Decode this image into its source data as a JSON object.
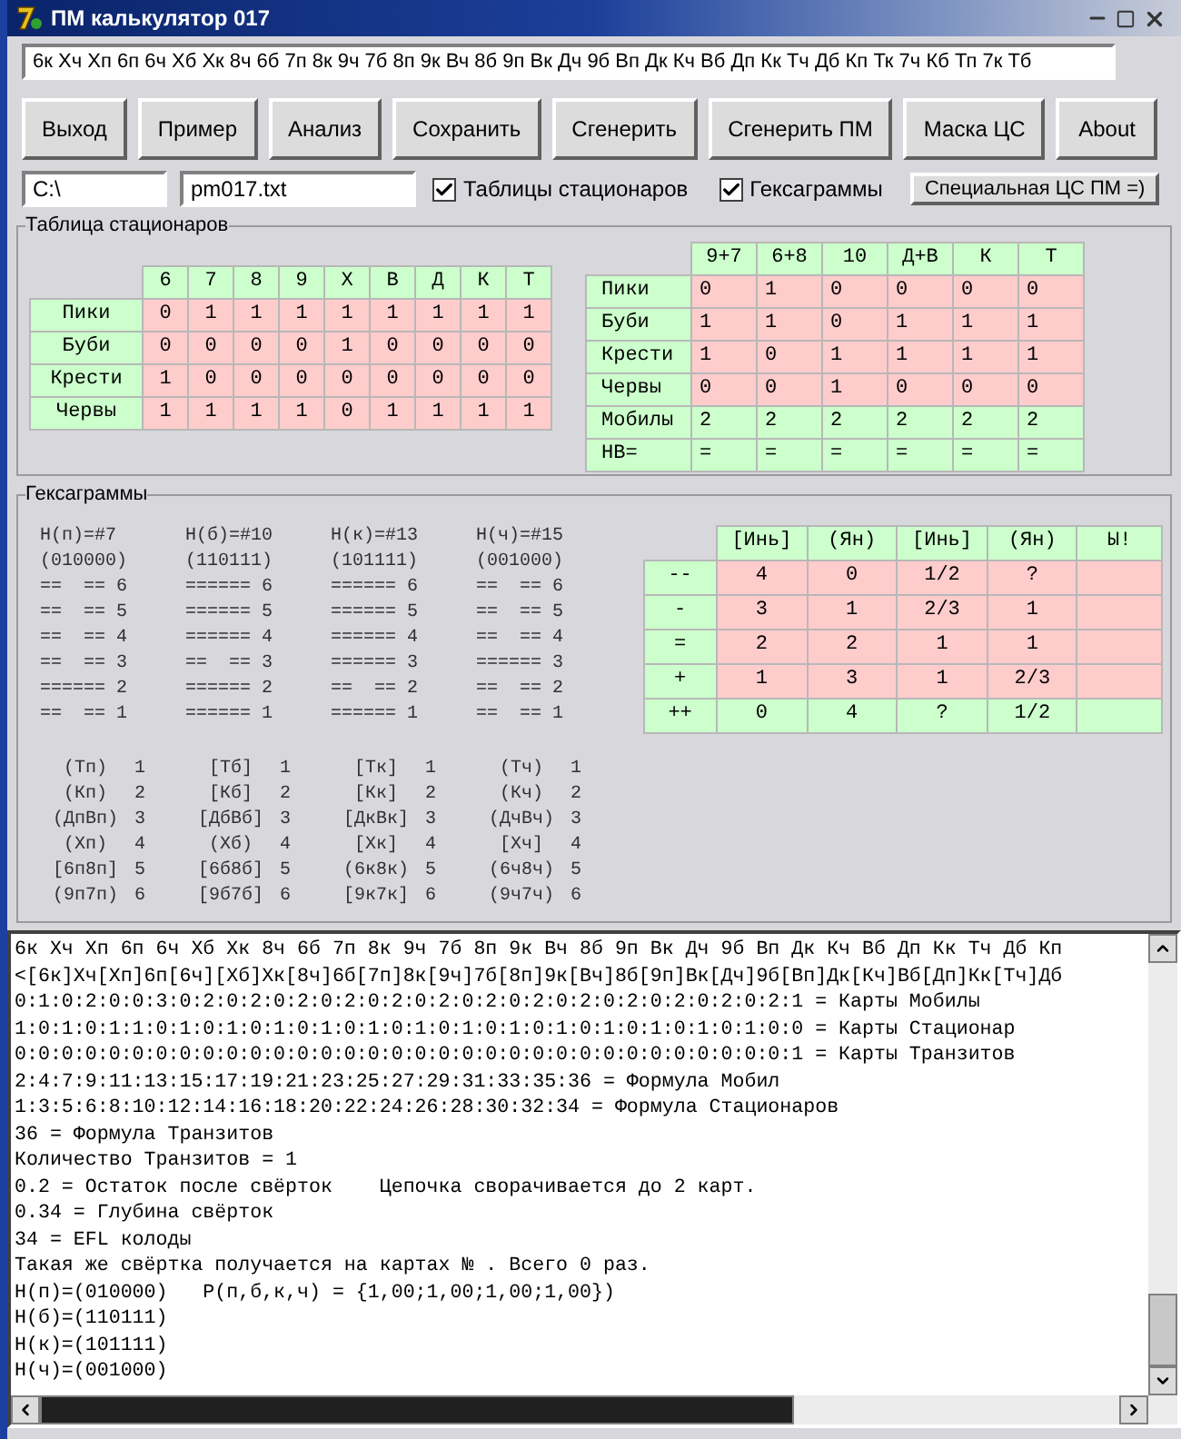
{
  "window": {
    "title": "ПМ калькулятор 017"
  },
  "sequence_field": {
    "value": "6к Хч Хп 6п 6ч Хб Хк 8ч 6б 7п 8к 9ч 7б 8п 9к Вч 8б 9п Вк Дч 9б Вп Дк Кч Вб Дп Кк Тч Дб Кп Тк 7ч Кб Тп 7к Тб"
  },
  "buttons": [
    "Выход",
    "Пример",
    "Анализ",
    "Сохранить",
    "Сгенерить",
    "Сгенерить ПМ",
    "Маска ЦС",
    "About"
  ],
  "path_field": {
    "value": "C:\\"
  },
  "file_field": {
    "value": "pm017.txt"
  },
  "checkboxes": [
    {
      "label": "Таблицы стационаров",
      "checked": true
    },
    {
      "label": "Гексаграммы",
      "checked": true
    }
  ],
  "special_button": "Специальная ЦС ПМ =)",
  "stationary_group": {
    "title": "Таблица стационаров",
    "left_table": {
      "columns": [
        "6",
        "7",
        "8",
        "9",
        "Х",
        "В",
        "Д",
        "К",
        "Т"
      ],
      "rows": [
        {
          "label": "Пики",
          "kind": "suit",
          "cells": [
            "0",
            "1",
            "1",
            "1",
            "1",
            "1",
            "1",
            "1",
            "1"
          ]
        },
        {
          "label": "Буби",
          "kind": "suit",
          "cells": [
            "0",
            "0",
            "0",
            "0",
            "1",
            "0",
            "0",
            "0",
            "0"
          ]
        },
        {
          "label": "Крести",
          "kind": "suit",
          "cells": [
            "1",
            "0",
            "0",
            "0",
            "0",
            "0",
            "0",
            "0",
            "0"
          ]
        },
        {
          "label": "Червы",
          "kind": "suit",
          "cells": [
            "1",
            "1",
            "1",
            "1",
            "0",
            "1",
            "1",
            "1",
            "1"
          ]
        }
      ]
    },
    "right_table": {
      "columns": [
        "9+7",
        "6+8",
        "10",
        "Д+В",
        "К",
        "Т"
      ],
      "rows": [
        {
          "label": "Пики",
          "kind": "suit",
          "cells": [
            "0",
            "1",
            "0",
            "0",
            "0",
            "0"
          ]
        },
        {
          "label": "Буби",
          "kind": "suit",
          "cells": [
            "1",
            "1",
            "0",
            "1",
            "1",
            "1"
          ]
        },
        {
          "label": "Крести",
          "kind": "suit",
          "cells": [
            "1",
            "0",
            "1",
            "1",
            "1",
            "1"
          ]
        },
        {
          "label": "Червы",
          "kind": "suit",
          "cells": [
            "0",
            "0",
            "1",
            "0",
            "0",
            "0"
          ]
        },
        {
          "label": "Мобилы",
          "kind": "total",
          "cells": [
            "2",
            "2",
            "2",
            "2",
            "2",
            "2"
          ]
        },
        {
          "label": "НВ=",
          "kind": "total",
          "cells": [
            "=",
            "=",
            "=",
            "=",
            "=",
            "="
          ]
        }
      ]
    }
  },
  "hexagram_group": {
    "title": "Гексаграммы",
    "hexagrams": [
      {
        "title": "Н(п)=#7",
        "code": "(010000)",
        "lines": [
          "==  == 6",
          "==  == 5",
          "==  == 4",
          "==  == 3",
          "====== 2",
          "==  == 1"
        ],
        "cards": [
          {
            "label": "(Тп)",
            "number": "1"
          },
          {
            "label": "(Кп)",
            "number": "2"
          },
          {
            "label": "(ДпВп)",
            "number": "3"
          },
          {
            "label": "(Хп)",
            "number": "4"
          },
          {
            "label": "[6п8п]",
            "number": "5"
          },
          {
            "label": "(9п7п)",
            "number": "6"
          }
        ]
      },
      {
        "title": "Н(б)=#10",
        "code": "(110111)",
        "lines": [
          "====== 6",
          "====== 5",
          "====== 4",
          "==  == 3",
          "====== 2",
          "====== 1"
        ],
        "cards": [
          {
            "label": "[Тб]",
            "number": "1"
          },
          {
            "label": "[Кб]",
            "number": "2"
          },
          {
            "label": "[ДбВб]",
            "number": "3"
          },
          {
            "label": "(Хб)",
            "number": "4"
          },
          {
            "label": "[6б8б]",
            "number": "5"
          },
          {
            "label": "[9б7б]",
            "number": "6"
          }
        ]
      },
      {
        "title": "Н(к)=#13",
        "code": "(101111)",
        "lines": [
          "====== 6",
          "====== 5",
          "====== 4",
          "====== 3",
          "==  == 2",
          "====== 1"
        ],
        "cards": [
          {
            "label": "[Тк]",
            "number": "1"
          },
          {
            "label": "[Кк]",
            "number": "2"
          },
          {
            "label": "[ДкВк]",
            "number": "3"
          },
          {
            "label": "[Хк]",
            "number": "4"
          },
          {
            "label": "(6к8к)",
            "number": "5"
          },
          {
            "label": "[9к7к]",
            "number": "6"
          }
        ]
      },
      {
        "title": "Н(ч)=#15",
        "code": "(001000)",
        "lines": [
          "==  == 6",
          "==  == 5",
          "==  == 4",
          "====== 3",
          "==  == 2",
          "==  == 1"
        ],
        "cards": [
          {
            "label": "(Тч)",
            "number": "1"
          },
          {
            "label": "(Кч)",
            "number": "2"
          },
          {
            "label": "(ДчВч)",
            "number": "3"
          },
          {
            "label": "[Хч]",
            "number": "4"
          },
          {
            "label": "(6ч8ч)",
            "number": "5"
          },
          {
            "label": "(9ч7ч)",
            "number": "6"
          }
        ]
      }
    ],
    "yin_yang_table": {
      "columns": [
        "[Инь]",
        "(Ян)",
        "[Инь]",
        "(Ян)",
        "Ы!"
      ],
      "rows": [
        {
          "label": "--",
          "kind": "level",
          "cells": [
            "4",
            "0",
            "1/2",
            "?",
            ""
          ]
        },
        {
          "label": "-",
          "kind": "level",
          "cells": [
            "3",
            "1",
            "2/3",
            "1",
            ""
          ]
        },
        {
          "label": "=",
          "kind": "level",
          "cells": [
            "2",
            "2",
            "1",
            "1",
            ""
          ]
        },
        {
          "label": "+",
          "kind": "level",
          "cells": [
            "1",
            "3",
            "1",
            "2/3",
            ""
          ]
        },
        {
          "label": "++",
          "kind": "total",
          "cells": [
            "0",
            "4",
            "?",
            "1/2",
            ""
          ]
        }
      ]
    }
  },
  "output_lines": [
    "6к Хч Хп 6п 6ч Хб Хк 8ч 6б 7п 8к 9ч 7б 8п 9к Вч 8б 9п Вк Дч 9б Вп Дк Кч Вб Дп Кк Тч Дб Кп",
    "<[6к]Хч[Хп]6п[6ч][Хб]Хк[8ч]6б[7п]8к[9ч]7б[8п]9к[Вч]8б[9п]Вк[Дч]9б[Вп]Дк[Кч]Вб[Дп]Кк[Тч]Дб",
    "0:1:0:2:0:0:3:0:2:0:2:0:2:0:2:0:2:0:2:0:2:0:2:0:2:0:2:0:2:0:2:0:2:1 = Карты Мобилы",
    "1:0:1:0:1:1:0:1:0:1:0:1:0:1:0:1:0:1:0:1:0:1:0:1:0:1:0:1:0:1:0:1:0:0 = Карты Стационар",
    "0:0:0:0:0:0:0:0:0:0:0:0:0:0:0:0:0:0:0:0:0:0:0:0:0:0:0:0:0:0:0:0:0:1 = Карты Транзитов",
    "2:4:7:9:11:13:15:17:19:21:23:25:27:29:31:33:35:36 = Формула Мобил",
    "1:3:5:6:8:10:12:14:16:18:20:22:24:26:28:30:32:34 = Формула Стационаров",
    "36 = Формула Транзитов",
    "Количество Транзитов = 1",
    "0.2 = Остаток после свёрток    Цепочка сворачивается до 2 карт.",
    "0.34 = Глубина свёрток",
    "34 = EFL колоды",
    "Такая же свёртка получается на картах № . Всего 0 раз.",
    "Н(п)=(010000)   Р(п,б,к,ч) = {1,00;1,00;1,00;1,00})",
    "Н(б)=(110111)",
    "Н(к)=(101111)",
    "Н(ч)=(001000)"
  ]
}
